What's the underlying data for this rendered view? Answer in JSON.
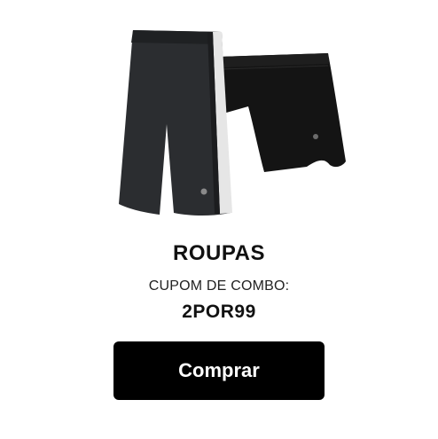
{
  "product": {
    "image_icon": "shorts-product-image",
    "category": "ROUPAS",
    "coupon_label": "CUPOM DE COMBO:",
    "coupon_code": "2POR99"
  },
  "actions": {
    "buy_label": "Comprar"
  },
  "colors": {
    "button_bg": "#000000",
    "button_text": "#ffffff",
    "text_primary": "#111111",
    "short_dark": "#2b2d30",
    "short_stripe": "#e6e6e6",
    "short_black": "#141414"
  }
}
